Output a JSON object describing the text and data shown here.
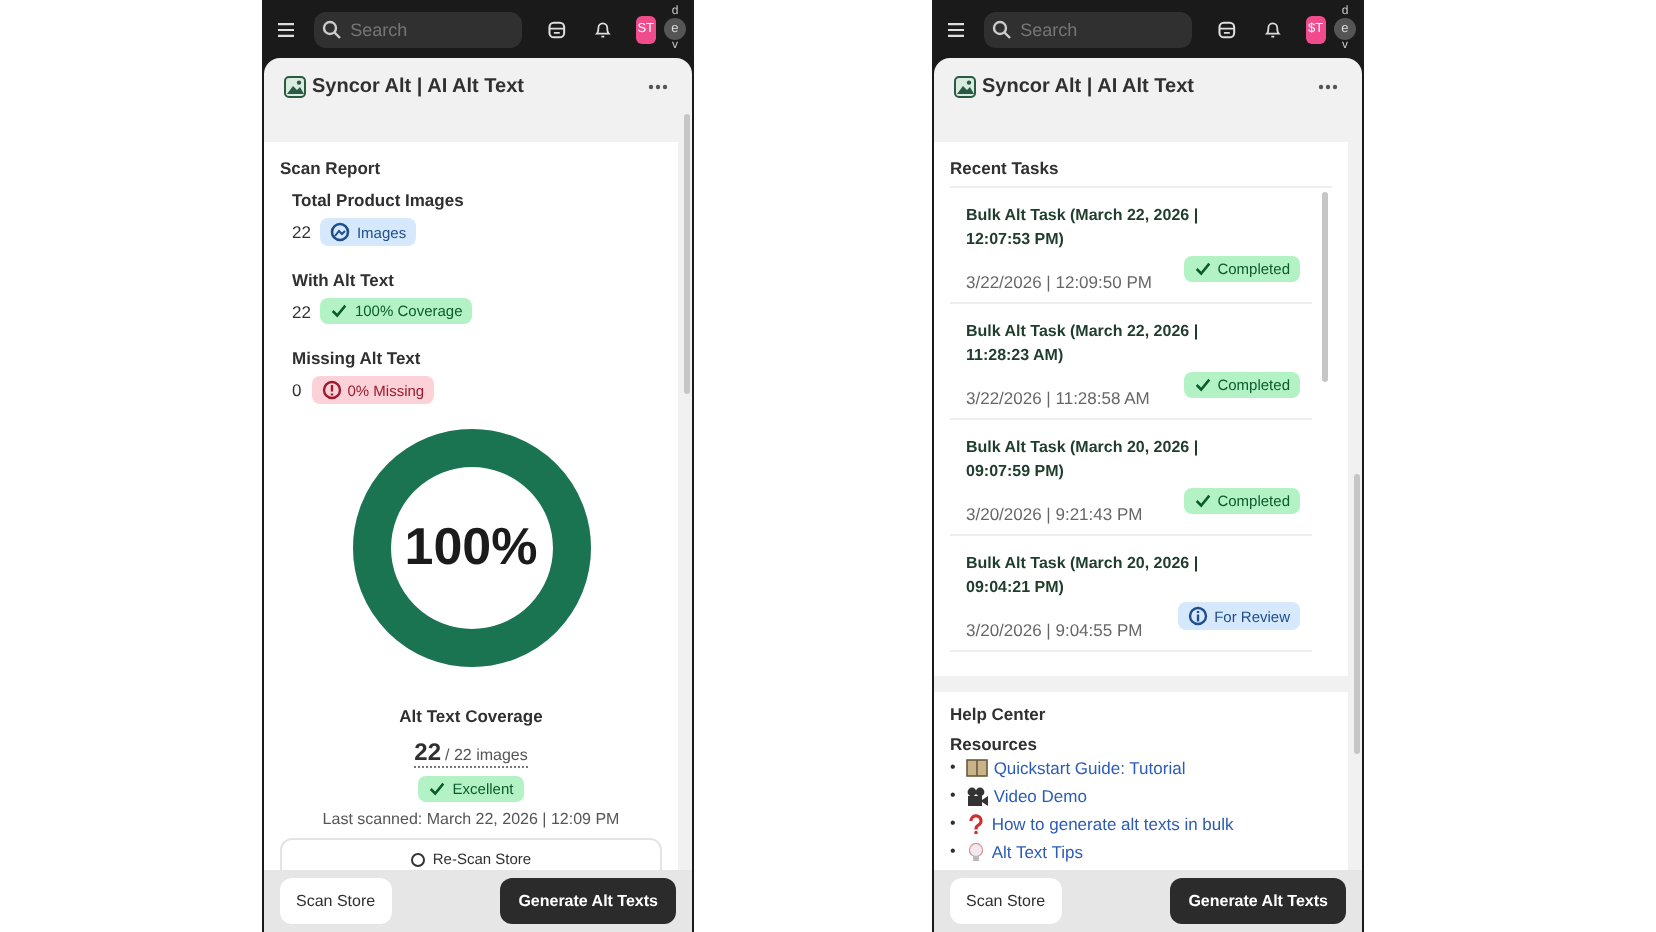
{
  "screens": [
    {
      "kind": "scan_report",
      "topbar": {
        "search": {
          "placeholder": "Search"
        },
        "avatar": "ST",
        "user_initial": "e",
        "user_top": "d",
        "user_bottom": "v"
      },
      "app_title": "Syncor Alt | AI Alt Text",
      "report": {
        "title": "Scan Report",
        "stats": [
          {
            "label": "Total Product Images",
            "value": "22",
            "badge": {
              "kind": "info",
              "text": "Images"
            }
          },
          {
            "label": "With Alt Text",
            "value": "22",
            "badge": {
              "kind": "success",
              "text": "100% Coverage"
            }
          },
          {
            "label": "Missing Alt Text",
            "value": "0",
            "badge": {
              "kind": "danger",
              "text": "0% Missing"
            }
          }
        ],
        "ring": {
          "level": 1,
          "text": "100%"
        },
        "coverage_label": "Alt Text Coverage",
        "count": "22",
        "count_total": "/ 22 images",
        "rating": "Excellent",
        "last_scanned": "Last scanned: March 22, 2026 | 12:09 PM",
        "rescan_button": "Re-Scan Store"
      },
      "footer": {
        "secondary": "Scan Store",
        "primary": "Generate Alt Texts"
      }
    },
    {
      "kind": "tasks",
      "topbar": {
        "search": {
          "placeholder": "Search"
        },
        "avatar": "$T",
        "user_initial": "e",
        "user_top": "d",
        "user_bottom": "v"
      },
      "app_title": "Syncor Alt | AI Alt Text",
      "recent": {
        "title": "Recent Tasks",
        "tasks": [
          {
            "name": "Bulk Alt Task (March 22, 2026 | 12:07:53 PM)",
            "date": "3/22/2026 | 12:09:50 PM",
            "status": {
              "kind": "success",
              "text": "Completed"
            }
          },
          {
            "name": "Bulk Alt Task (March 22, 2026 | 11:28:23 AM)",
            "date": "3/22/2026 | 11:28:58 AM",
            "status": {
              "kind": "success",
              "text": "Completed"
            }
          },
          {
            "name": "Bulk Alt Task (March 20, 2026 | 09:07:59 PM)",
            "date": "3/20/2026 | 9:21:43 PM",
            "status": {
              "kind": "success",
              "text": "Completed"
            }
          },
          {
            "name": "Bulk Alt Task (March 20, 2026 | 09:04:21 PM)",
            "date": "3/20/2026 | 9:04:55 PM",
            "status": {
              "kind": "review",
              "text": "For Review"
            }
          }
        ]
      },
      "help": {
        "title": "Help Center",
        "subtitle": "Resources",
        "links": [
          {
            "kind": "guide",
            "bullet": "•",
            "text": "Quickstart Guide: Tutorial"
          },
          {
            "kind": "video",
            "bullet": "•",
            "text": "Video Demo"
          },
          {
            "kind": "faq",
            "bullet": "•",
            "text": "How to generate alt texts in bulk"
          },
          {
            "kind": "tips",
            "bullet": "•",
            "text": "Alt Text Tips"
          }
        ]
      },
      "footer": {
        "secondary": "Scan Store",
        "primary": "Generate Alt Texts"
      }
    }
  ]
}
